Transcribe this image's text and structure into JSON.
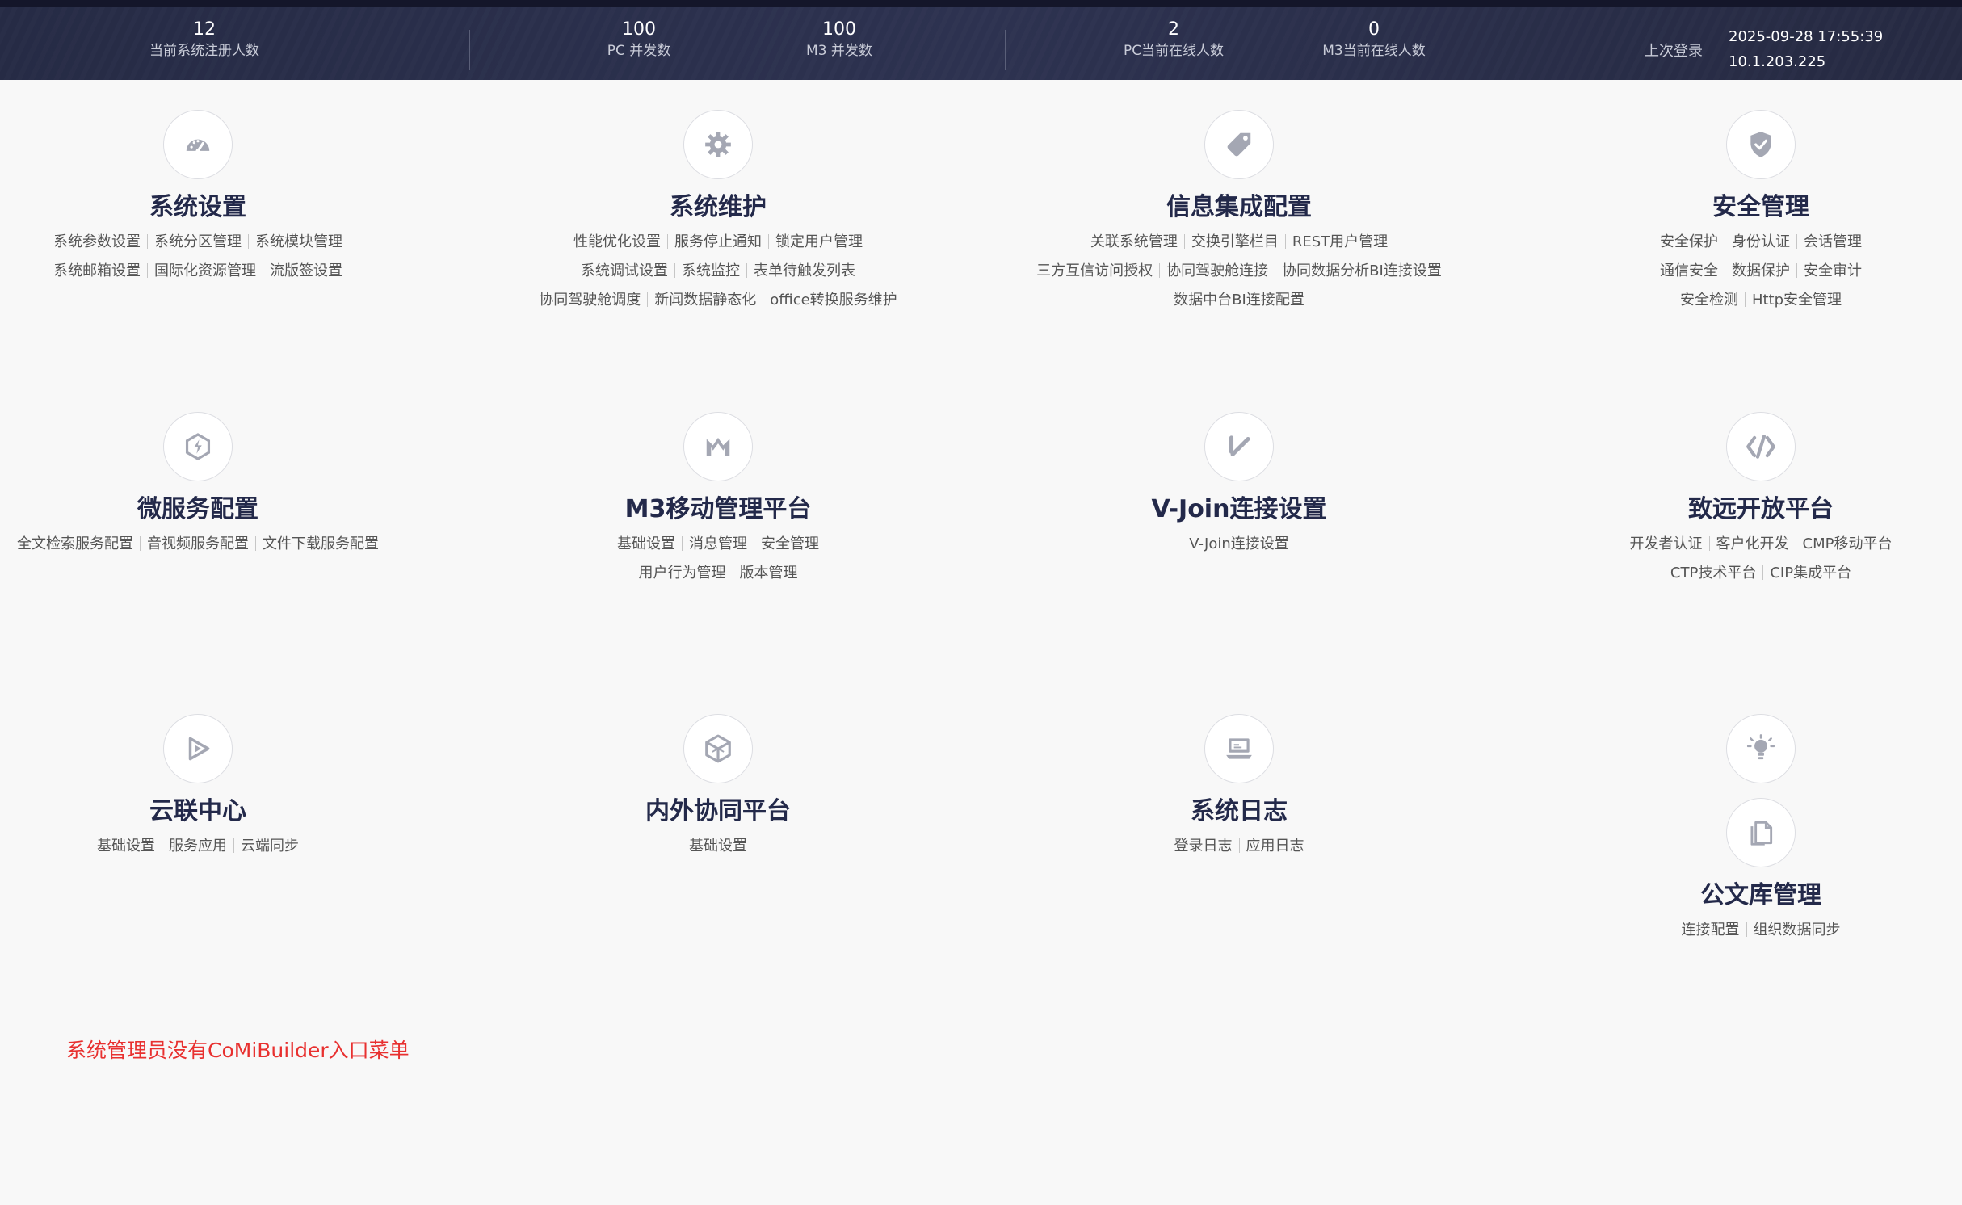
{
  "stats": {
    "registered": {
      "value": "12",
      "label": "当前系统注册人数"
    },
    "pc_concurrency": {
      "value": "100",
      "label": "PC 并发数"
    },
    "m3_concurrency": {
      "value": "100",
      "label": "M3 并发数"
    },
    "pc_online": {
      "value": "2",
      "label": "PC当前在线人数"
    },
    "m3_online": {
      "value": "0",
      "label": "M3当前在线人数"
    },
    "last_login": {
      "label": "上次登录",
      "time": "2025-09-28 17:55:39",
      "ip": "10.1.203.225"
    }
  },
  "modules": [
    {
      "title": "系统设置",
      "icon": "dashboard-icon",
      "lines": [
        [
          "系统参数设置",
          "系统分区管理",
          "系统模块管理"
        ],
        [
          "系统邮箱设置",
          "国际化资源管理",
          "流版签设置"
        ]
      ]
    },
    {
      "title": "系统维护",
      "icon": "gear-icon",
      "lines": [
        [
          "性能优化设置",
          "服务停止通知",
          "锁定用户管理"
        ],
        [
          "系统调试设置",
          "系统监控",
          "表单待触发列表"
        ],
        [
          "协同驾驶舱调度",
          "新闻数据静态化",
          "office转换服务维护"
        ]
      ]
    },
    {
      "title": "信息集成配置",
      "icon": "tag-icon",
      "lines": [
        [
          "关联系统管理",
          "交换引擎栏目",
          "REST用户管理"
        ],
        [
          "三方互信访问授权",
          "协同驾驶舱连接",
          "协同数据分析BI连接设置"
        ],
        [
          "数据中台BI连接配置"
        ]
      ]
    },
    {
      "title": "安全管理",
      "icon": "shield-icon",
      "lines": [
        [
          "安全保护",
          "身份认证",
          "会话管理"
        ],
        [
          "通信安全",
          "数据保护",
          "安全审计"
        ],
        [
          "安全检测",
          "Http安全管理"
        ]
      ]
    },
    {
      "title": "微服务配置",
      "icon": "hexagon-bolt-icon",
      "lines": [
        [
          "全文检索服务配置",
          "音视频服务配置",
          "文件下载服务配置"
        ]
      ]
    },
    {
      "title": "M3移动管理平台",
      "icon": "m-logo-icon",
      "lines": [
        [
          "基础设置",
          "消息管理",
          "安全管理"
        ],
        [
          "用户行为管理",
          "版本管理"
        ]
      ]
    },
    {
      "title": "V-Join连接设置",
      "icon": "v-check-icon",
      "lines": [
        [
          "V-Join连接设置"
        ]
      ]
    },
    {
      "title": "致远开放平台",
      "icon": "code-icon",
      "lines": [
        [
          "开发者认证",
          "客户化开发",
          "CMP移动平台"
        ],
        [
          "CTP技术平台",
          "CIP集成平台"
        ]
      ]
    },
    {
      "title": "云联中心",
      "icon": "cloud-play-icon",
      "lines": [
        [
          "基础设置",
          "服务应用",
          "云端同步"
        ]
      ]
    },
    {
      "title": "内外协同平台",
      "icon": "cube-icon",
      "lines": [
        [
          "基础设置"
        ]
      ]
    },
    {
      "title": "系统日志",
      "icon": "laptop-icon",
      "lines": [
        [
          "登录日志",
          "应用日志"
        ]
      ]
    },
    {
      "title": "公文库管理",
      "icon": "document-icon",
      "extra_icon": "lightbulb-icon",
      "lines": [
        [
          "连接配置",
          "组织数据同步"
        ]
      ]
    }
  ],
  "note": "系统管理员没有CoMiBuilder入口菜单"
}
